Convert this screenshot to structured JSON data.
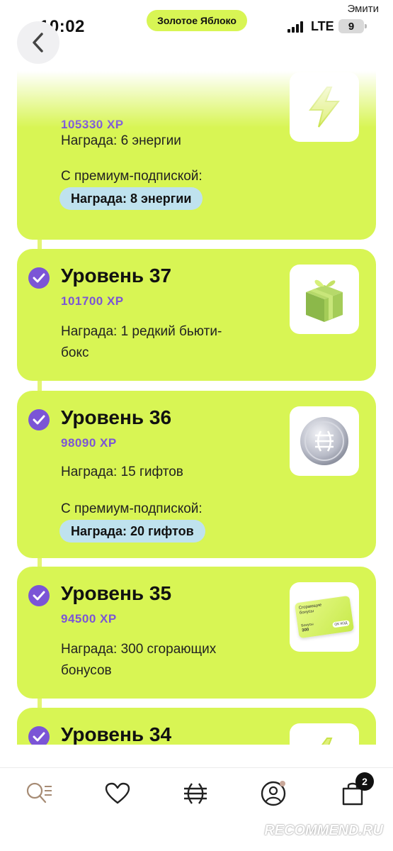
{
  "status_bar": {
    "time": "10:02",
    "app_name": "Золотое Яблоко",
    "carrier": "Эмити",
    "network": "LTE",
    "battery": "9"
  },
  "levels": [
    {
      "xp": "105330 XP",
      "reward": "Награда: 6 энергии",
      "premium_label": "С премиум-подпиской:",
      "premium_reward": "Награда: 8 энергии",
      "icon": "lightning-icon"
    },
    {
      "title": "Уровень 37",
      "xp": "101700 XP",
      "reward_line1": "Награда: 1 редкий бьюти-",
      "reward_line2": "бокс",
      "icon": "gift-box-icon"
    },
    {
      "title": "Уровень 36",
      "xp": "98090 XP",
      "reward": "Награда: 15 гифтов",
      "premium_label": "С премиум-подпиской:",
      "premium_reward": "Награда: 20 гифтов",
      "icon": "coin-icon"
    },
    {
      "title": "Уровень 35",
      "xp": "94500 XP",
      "reward_line1": "Награда: 300 сгорающих",
      "reward_line2": "бонусов",
      "icon": "bonus-card-icon",
      "card_text": "Сгорающие бонусы",
      "card_amount_label": "Бонусы",
      "card_amount": "300",
      "card_button": "ОК КОД"
    },
    {
      "title": "Уровень 34",
      "icon": "lightning-icon"
    }
  ],
  "nav": {
    "items": [
      "search-icon",
      "heart-icon",
      "brand-logo-icon",
      "profile-icon",
      "bag-icon"
    ],
    "cart_count": "2"
  },
  "watermark": "RECOMMEND.RU",
  "colors": {
    "card_bg": "#d8f554",
    "accent_purple": "#7b55d6",
    "premium_badge": "#bfe2ee"
  }
}
